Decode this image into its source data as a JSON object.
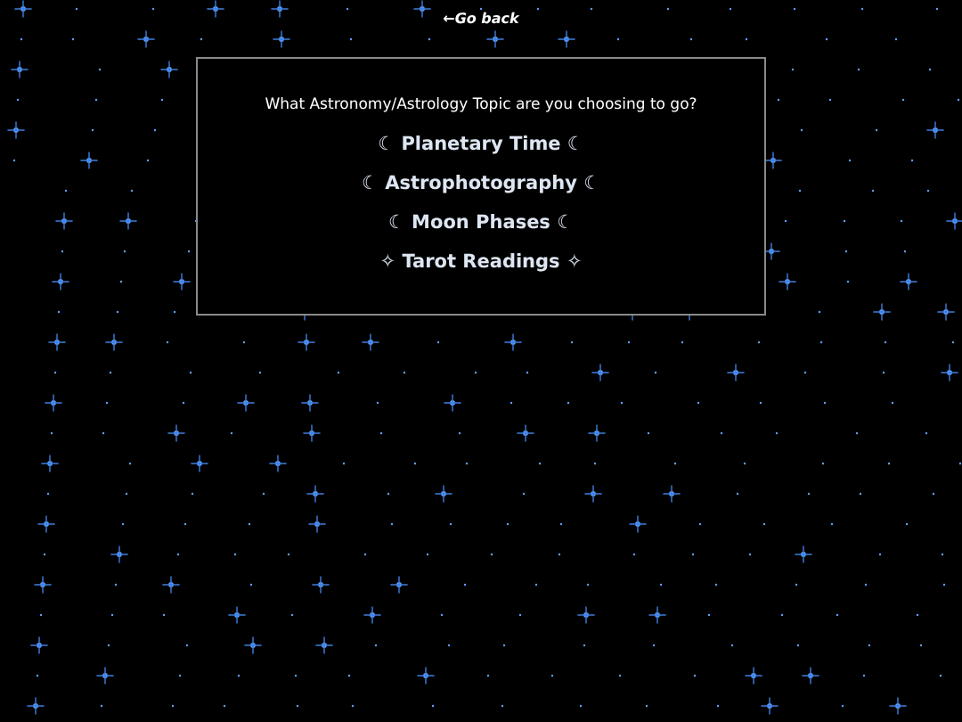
{
  "back_link": "←Go back",
  "panel": {
    "question": "What Astronomy/Astrology Topic are you choosing to go?",
    "topics": [
      {
        "label": "☾ Planetary Time ☾"
      },
      {
        "label": "☾ Astrophotography ☾"
      },
      {
        "label": "☾ Moon Phases ☾"
      },
      {
        "label": "✧ Tarot Readings ✧"
      }
    ]
  }
}
